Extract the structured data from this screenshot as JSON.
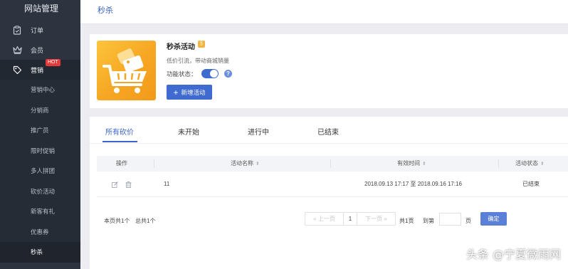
{
  "sidebar": {
    "brand": "网站管理",
    "main_items": [
      {
        "label": "订单",
        "icon": "clipboard-icon"
      },
      {
        "label": "会员",
        "icon": "crown-icon"
      },
      {
        "label": "营销",
        "icon": "tag-icon",
        "badge": "HOT"
      }
    ],
    "sub_items": [
      {
        "label": "营销中心"
      },
      {
        "label": "分销商"
      },
      {
        "label": "推广员"
      },
      {
        "label": "限时促销"
      },
      {
        "label": "多人拼团"
      },
      {
        "label": "砍价活动"
      },
      {
        "label": "新客有礼"
      },
      {
        "label": "优惠券"
      },
      {
        "label": "秒杀"
      }
    ]
  },
  "topbar": {
    "title": "秒杀"
  },
  "activity": {
    "title": "秒杀活动",
    "description": "低价引流，带动商城销量",
    "status_label": "功能状态：",
    "toggle_on": true,
    "new_button": "新增活动"
  },
  "tabs": [
    "所有砍价",
    "未开始",
    "进行中",
    "已结束"
  ],
  "table": {
    "headers": [
      "操作",
      "活动名称",
      "有效时间",
      "活动状态"
    ],
    "rows": [
      {
        "name": "11",
        "time": "2018.09.13 17:17 至 2018.09.16 17:16",
        "status": "已结束"
      }
    ]
  },
  "footer": {
    "page_count_text": "本页共1个",
    "total_text": "总共1个",
    "prev": "上一页",
    "page": "1",
    "next": "下一页",
    "total_pages": "共1页",
    "goto_label": "到第",
    "page_unit": "页",
    "confirm": "确定"
  },
  "watermark": "头条 @宁夏微雨网",
  "colors": {
    "accent": "#3a62c8",
    "sidebar_bg": "#2e343f",
    "hot": "#e33b3b",
    "promo": "#f6a622"
  }
}
